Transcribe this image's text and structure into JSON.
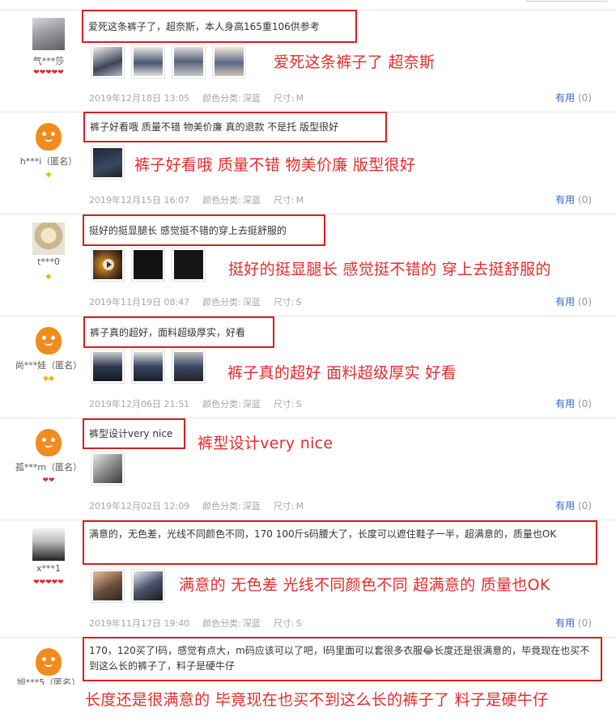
{
  "labels": {
    "color_key": "颜色分类:",
    "size_key": "尺寸:",
    "useful": "有用",
    "useful_count": "(0)"
  },
  "reviews": [
    {
      "user": "气***莎",
      "level": "❤❤❤❤❤",
      "text": "爱死这条裤子了，超奈斯，本人身高165重106供参考",
      "annotation": "爱死这条裤子了  超奈斯",
      "date": "2019年12月18日 13:05",
      "color": "深蓝",
      "size": "M"
    },
    {
      "user": "h***i（匿名）",
      "level": "◆",
      "text": "裤子好看哦 质量不错 物美价廉 真的退款 不是托 版型很好",
      "annotation": "裤子好看哦  质量不错  物美价廉  版型很好",
      "date": "2019年12月15日 16:07",
      "color": "深蓝",
      "size": "M"
    },
    {
      "user": "t***0",
      "level": "◆",
      "text": "挺好的挺显腿长 感觉挺不错的穿上去挺舒服的",
      "annotation": "挺好的挺显腿长  感觉挺不错的  穿上去挺舒服的",
      "date": "2019年11月19日 08:47",
      "color": "深蓝",
      "size": "S"
    },
    {
      "user": "尚***娃（匿名）",
      "level": "◆◆",
      "text": "裤子真的超好，面料超级厚实，好看",
      "annotation": "裤子真的超好  面料超级厚实  好看",
      "date": "2019年12月06日 21:51",
      "color": "深蓝",
      "size": "S"
    },
    {
      "user": "孤***m（匿名）",
      "level": "❤❤",
      "text": "裤型设计very nice",
      "annotation": "裤型设计very nice",
      "date": "2019年12月02日 12:09",
      "color": "深蓝",
      "size": "M"
    },
    {
      "user": "x***1",
      "level": "❤❤❤❤❤",
      "text": "满意的，无色差，光线不同颜色不同，170 100斤s码腰大了，长度可以遮住鞋子一半，超满意的，质量也OK",
      "annotation": "满意的  无色差  光线不同颜色不同  超满意的  质量也OK",
      "date": "2019年11月17日 19:40",
      "color": "深蓝",
      "size": "S"
    },
    {
      "user": "旭***5（匿名）",
      "text": "170，120买了l码，感觉有点大，m码应该可以了吧，l码里面可以套很多衣服😂长度还是很满意的，毕竟现在也买不到这么长的裤子了，料子是硬牛仔",
      "annotation": "长度还是很满意的  毕竟现在也买不到这么长的裤子了  料子是硬牛仔"
    }
  ]
}
